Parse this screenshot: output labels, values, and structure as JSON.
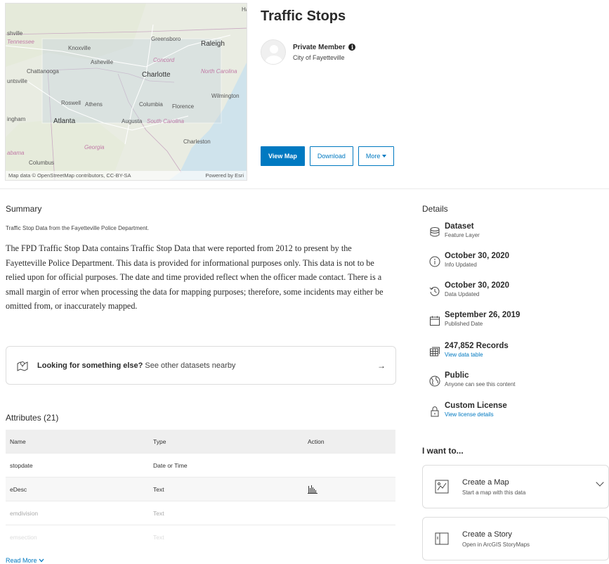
{
  "item": {
    "title": "Traffic Stops",
    "owner_name": "Private Member",
    "owner_org": "City of Fayetteville"
  },
  "map": {
    "attribution_left": "Map data © OpenStreetMap contributors, CC-BY-SA",
    "attribution_right": "Powered by Esri",
    "labels": {
      "ha": "Ha",
      "shville": "shville",
      "tennessee": "Tennessee",
      "knoxville": "Knoxville",
      "greensboro": "Greensboro",
      "raleigh": "Raleigh",
      "asheville": "Asheville",
      "concord": "Concord",
      "chattanooga": "Chattanooga",
      "charlotte": "Charlotte",
      "north_carolina": "North Carolina",
      "untsville": "untsville",
      "roswell": "Roswell",
      "athens": "Athens",
      "columbia": "Columbia",
      "wilmington": "Wilmington",
      "florence": "Florence",
      "ingham": "ingham",
      "atlanta": "Atlanta",
      "augusta": "Augusta",
      "south_carolina": "South Carolina",
      "charleston": "Charleston",
      "georgia": "Georgia",
      "abama": "abama",
      "columbus": "Columbus"
    }
  },
  "actions": {
    "view_map": "View Map",
    "download": "Download",
    "more": "More"
  },
  "summary": {
    "heading": "Summary",
    "short": "Traffic Stop Data from the Fayetteville Police Department.",
    "description": "The FPD Traffic Stop Data contains Traffic Stop Data that were reported from 2012 to present by the Fayetteville Police Department. This data is provided for informational purposes only. This data is not to be relied upon for official purposes. The date and time provided reflect when the officer made contact. There is a small margin of error when processing the data for mapping purposes; therefore, some incidents may either be omitted from, or inaccurately mapped."
  },
  "looking": {
    "bold": "Looking for something else?",
    "rest": "See other datasets nearby",
    "arrow": "→"
  },
  "attributes": {
    "heading": "Attributes (21)",
    "columns": [
      "Name",
      "Type",
      "Action"
    ],
    "rows": [
      {
        "name": "stopdate",
        "type": "Date or Time"
      },
      {
        "name": "eDesc",
        "type": "Text"
      },
      {
        "name": "emdivision",
        "type": "Text"
      },
      {
        "name": "emsection",
        "type": "Text"
      }
    ],
    "read_more": "Read More"
  },
  "details": {
    "heading": "Details",
    "items": [
      {
        "main": "Dataset",
        "sub": "Feature Layer"
      },
      {
        "main": "October 30, 2020",
        "sub": "Info Updated"
      },
      {
        "main": "October 30, 2020",
        "sub": "Data Updated"
      },
      {
        "main": "September 26, 2019",
        "sub": "Published Date"
      },
      {
        "main": "247,852 Records",
        "sub": "View data table"
      },
      {
        "main": "Public",
        "sub": "Anyone can see this content"
      },
      {
        "main": "Custom License",
        "sub": "View license details"
      }
    ]
  },
  "want": {
    "heading": "I want to...",
    "cards": [
      {
        "main": "Create a Map",
        "sub": "Start a map with this data"
      },
      {
        "main": "Create a Story",
        "sub": "Open in ArcGIS StoryMaps"
      }
    ]
  },
  "colors": {
    "accent": "#0079c1",
    "water": "#cfe3ec",
    "land": "#eef0e6"
  }
}
